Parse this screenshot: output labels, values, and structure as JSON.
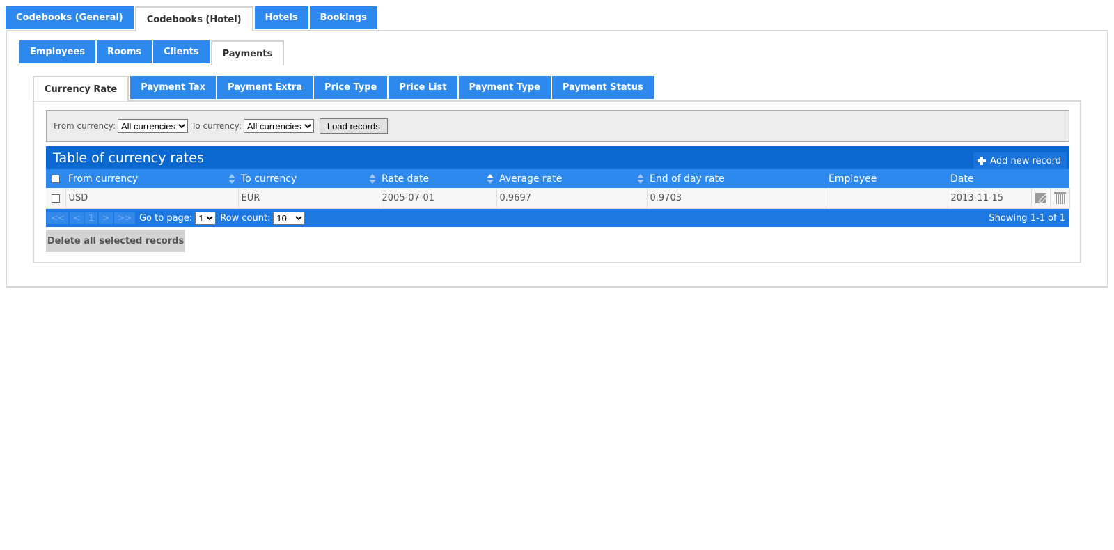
{
  "outer_tabs": [
    {
      "label": "Codebooks (General)",
      "active": false
    },
    {
      "label": "Codebooks (Hotel)",
      "active": true
    },
    {
      "label": "Hotels",
      "active": false
    },
    {
      "label": "Bookings",
      "active": false
    }
  ],
  "mid_tabs": [
    {
      "label": "Employees",
      "active": false
    },
    {
      "label": "Rooms",
      "active": false
    },
    {
      "label": "Clients",
      "active": false
    },
    {
      "label": "Payments",
      "active": true
    }
  ],
  "inner_tabs": [
    {
      "label": "Currency Rate",
      "active": true
    },
    {
      "label": "Payment Tax",
      "active": false
    },
    {
      "label": "Payment Extra",
      "active": false
    },
    {
      "label": "Price Type",
      "active": false
    },
    {
      "label": "Price List",
      "active": false
    },
    {
      "label": "Payment Type",
      "active": false
    },
    {
      "label": "Payment Status",
      "active": false
    }
  ],
  "filter": {
    "from_label": "From currency:",
    "from_value": "All currencies",
    "to_label": "To currency:",
    "to_value": "All currencies",
    "load_button": "Load records"
  },
  "table": {
    "title": "Table of currency rates",
    "add_button": "Add new record",
    "columns": [
      "From currency",
      "To currency",
      "Rate date",
      "Average rate",
      "End of day rate",
      "Employee",
      "Date"
    ],
    "sort": {
      "column": "Rate date",
      "direction": "asc"
    },
    "rows": [
      {
        "from": "USD",
        "to": "EUR",
        "rate_date": "2005-07-01",
        "average_rate": "0.9697",
        "end_of_day_rate": "0.9703",
        "employee": "",
        "date": "2013-11-15"
      }
    ],
    "footer": {
      "first": "<<",
      "prev": "<",
      "page": "1",
      "next": ">",
      "last": ">>",
      "goto_label": "Go to page:",
      "goto_value": "1",
      "rowcount_label": "Row count:",
      "rowcount_value": "10",
      "info": "Showing 1-1 of 1"
    }
  },
  "delete_selected_button": "Delete all selected records",
  "colors": {
    "tab_blue": "#2e89ee",
    "title_blue": "#0b68d0",
    "footer_blue": "#1e78e2"
  }
}
